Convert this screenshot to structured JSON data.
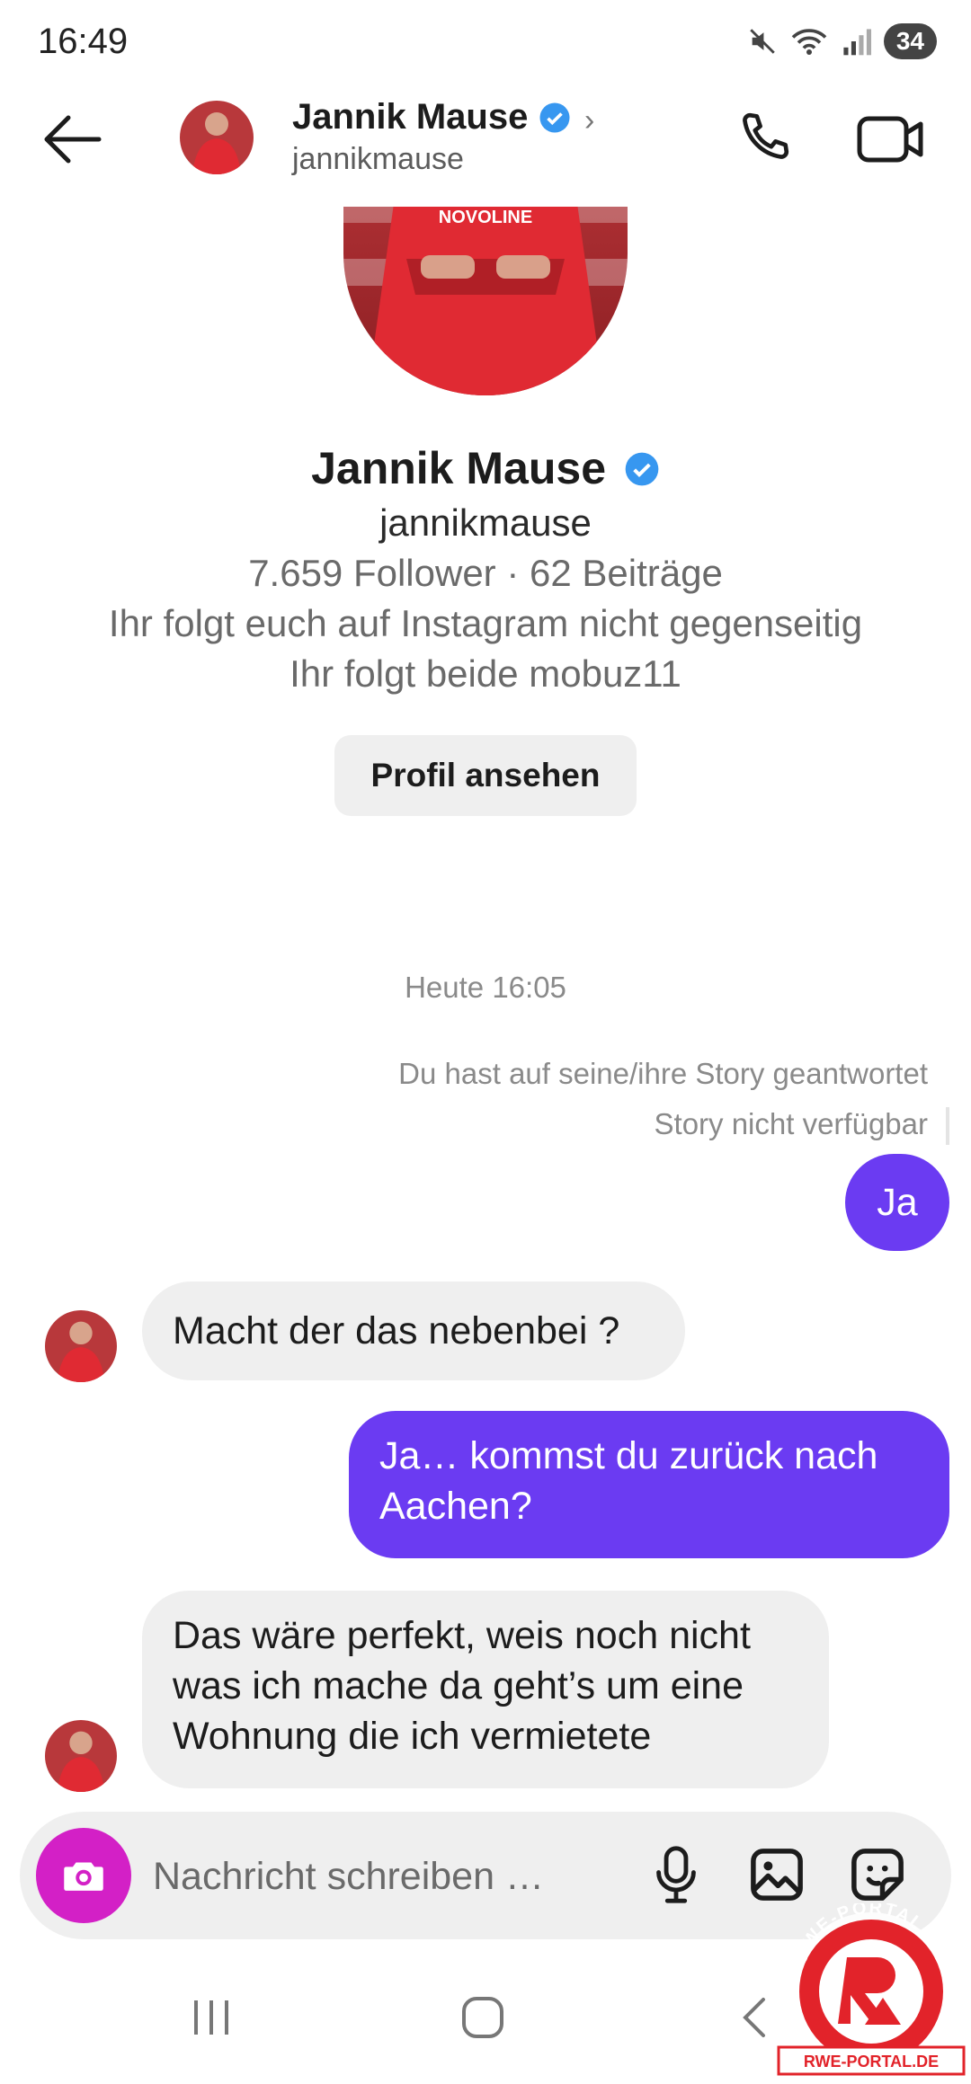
{
  "status_bar": {
    "time": "16:49",
    "battery": "34"
  },
  "header": {
    "name": "Jannik Mause",
    "username": "jannikmause",
    "chevron": "›"
  },
  "profile": {
    "name": "Jannik Mause",
    "username": "jannikmause",
    "stats": "7.659 Follower · 62 Beiträge",
    "follow_status": "Ihr folgt euch auf Instagram nicht gegenseitig",
    "mutual": "Ihr folgt beide mobuz11",
    "view_profile_label": "Profil ansehen",
    "jersey_text": "NOVOLINE"
  },
  "conversation": {
    "timestamp": "Heute 16:05",
    "story_reply_note": "Du hast auf seine/ihre Story geantwortet",
    "story_unavailable": "Story nicht verfügbar",
    "messages": [
      {
        "from": "me",
        "text": "Ja"
      },
      {
        "from": "them",
        "text": "Macht der das nebenbei ?"
      },
      {
        "from": "me",
        "text": "Ja… kommst du zurück nach Aachen?"
      },
      {
        "from": "them",
        "text": "Das wäre perfekt, weis noch nicht was ich mache da geht’s um eine Wohnung die ich vermietete"
      }
    ]
  },
  "composer": {
    "placeholder": "Nachricht schreiben …"
  },
  "icons": {
    "back": "back-arrow-icon",
    "verified": "verified-badge-icon",
    "call": "phone-icon",
    "video": "video-camera-icon",
    "camera": "camera-icon",
    "mic": "microphone-icon",
    "gallery": "image-icon",
    "sticker": "sticker-icon",
    "nav_recent": "recent-apps-icon",
    "nav_home": "home-icon",
    "nav_back": "nav-back-icon"
  },
  "watermark": {
    "top_text": "RWE-PORTAL.DE",
    "bottom_text": "RWE-PORTAL.DE"
  },
  "colors": {
    "outgoing_bubble": "#6b3bf2",
    "incoming_bubble": "#efefef",
    "camera_button": "#d320c6",
    "verified": "#3797f0",
    "jersey_red": "#d8282f"
  }
}
